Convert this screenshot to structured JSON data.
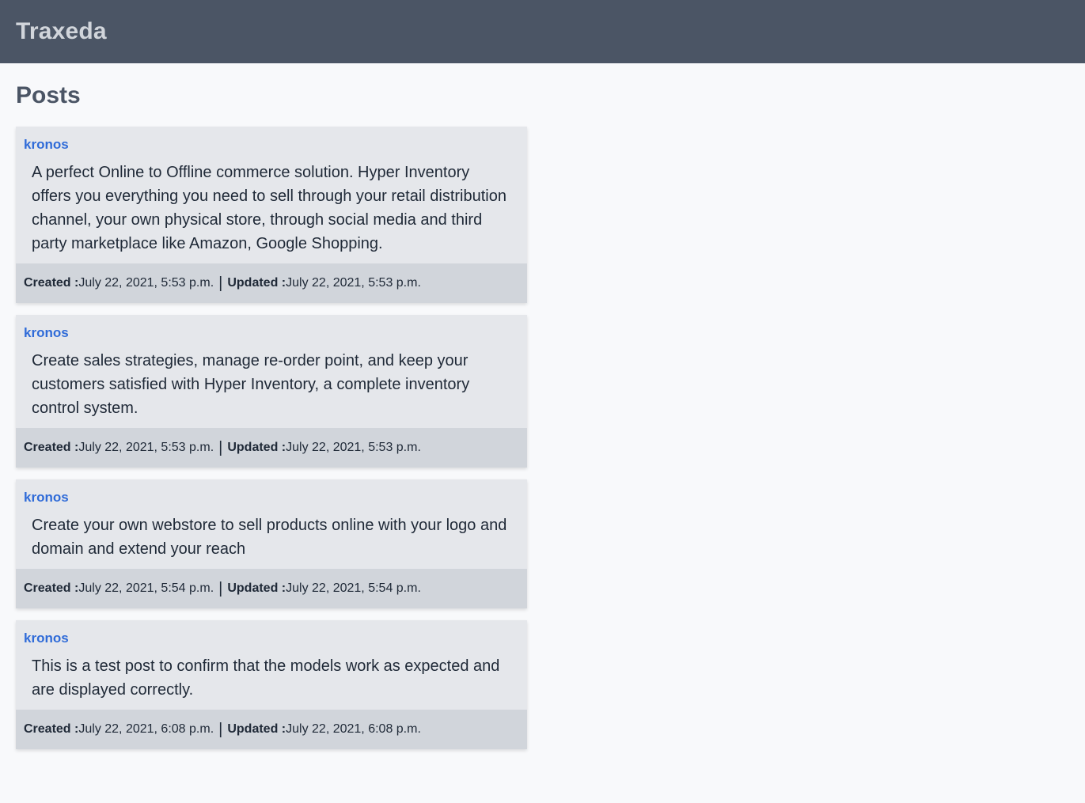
{
  "header": {
    "brand": "Traxeda"
  },
  "page": {
    "title": "Posts"
  },
  "posts": [
    {
      "author": "kronos",
      "body": "A perfect Online to Offline commerce solution. Hyper Inventory offers you everything you need to sell through your retail distribution channel, your own physical store, through social media and third party marketplace like Amazon, Google Shopping.",
      "created_label": "Created :",
      "created": "July 22, 2021, 5:53 p.m.",
      "separator": "|",
      "updated_label": "Updated :",
      "updated": "July 22, 2021, 5:53 p.m."
    },
    {
      "author": "kronos",
      "body": "Create sales strategies, manage re-order point, and keep your customers satisfied with Hyper Inventory, a complete inventory control system.",
      "created_label": "Created :",
      "created": "July 22, 2021, 5:53 p.m.",
      "separator": "|",
      "updated_label": "Updated :",
      "updated": "July 22, 2021, 5:53 p.m."
    },
    {
      "author": "kronos",
      "body": "Create your own webstore to sell products online with your logo and domain and extend your reach",
      "created_label": "Created :",
      "created": "July 22, 2021, 5:54 p.m.",
      "separator": "|",
      "updated_label": "Updated :",
      "updated": "July 22, 2021, 5:54 p.m."
    },
    {
      "author": "kronos",
      "body": "This is a test post to confirm that the models work as expected and are displayed correctly.",
      "created_label": "Created :",
      "created": "July 22, 2021, 6:08 p.m.",
      "separator": "|",
      "updated_label": "Updated :",
      "updated": "July 22, 2021, 6:08 p.m."
    }
  ],
  "colors": {
    "header_bg": "#4b5565",
    "brand_text": "#d1d5db",
    "page_bg": "#f8f9fb",
    "card_bg": "#e5e7eb",
    "footer_bg": "#d1d5db",
    "author_link": "#2f6bd8",
    "title_text": "#4b5565"
  }
}
